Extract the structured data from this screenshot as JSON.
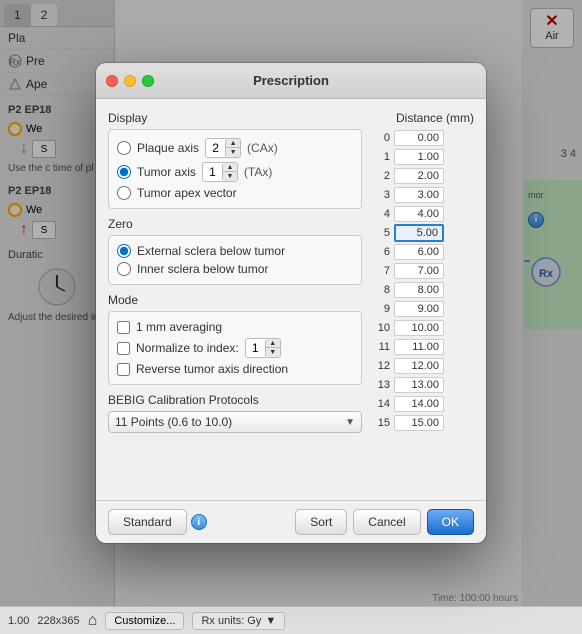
{
  "app": {
    "title": "Prescription",
    "bottom_bar": {
      "zoom": "1.00",
      "dimensions": "228x365",
      "customize_label": "Customize...",
      "rx_units_label": "Rx units: Gy"
    }
  },
  "sidebar": {
    "tabs": [
      {
        "label": "1",
        "active": false
      },
      {
        "label": "2",
        "active": false
      }
    ],
    "items": [
      {
        "label": "Pla"
      },
      {
        "label": "Pre"
      },
      {
        "label": "Ape"
      }
    ],
    "section1": "P2 EP18",
    "item1": "We",
    "section2": "P2 EP18",
    "item2": "We",
    "use_text": "Use the c time of pl",
    "duration_label": "Duratic",
    "adjust_text": "Adjust the desired in"
  },
  "dialog": {
    "title": "Prescription",
    "traffic_lights": {
      "close": "close",
      "minimize": "minimize",
      "maximize": "maximize"
    },
    "display_section": {
      "label": "Display",
      "plaque_axis": {
        "label": "Plaque axis",
        "value": "2",
        "tag": "(CAx)"
      },
      "tumor_axis": {
        "label": "Tumor axis",
        "value": "1",
        "tag": "(TAx)",
        "selected": true
      },
      "tumor_apex_vector": {
        "label": "Tumor apex vector"
      }
    },
    "zero_section": {
      "label": "Zero",
      "external_sclera": {
        "label": "External sclera below tumor",
        "selected": true
      },
      "inner_sclera": {
        "label": "Inner sclera below tumor"
      }
    },
    "mode_section": {
      "label": "Mode",
      "averaging": {
        "label": "1 mm averaging",
        "checked": false
      },
      "normalize": {
        "label": "Normalize to index:",
        "value": "1",
        "checked": false
      },
      "reverse": {
        "label": "Reverse tumor axis direction",
        "checked": false
      }
    },
    "calibration_section": {
      "label": "BEBIG Calibration Protocols",
      "dropdown_value": "11 Points (0.6 to 10.0)"
    },
    "distance_table": {
      "header": "Distance (mm)",
      "rows": [
        {
          "index": "0",
          "value": "0.00"
        },
        {
          "index": "1",
          "value": "1.00"
        },
        {
          "index": "2",
          "value": "2.00"
        },
        {
          "index": "3",
          "value": "3.00"
        },
        {
          "index": "4",
          "value": "4.00"
        },
        {
          "index": "5",
          "value": "5.00",
          "highlighted": true
        },
        {
          "index": "6",
          "value": "6.00"
        },
        {
          "index": "7",
          "value": "7.00"
        },
        {
          "index": "8",
          "value": "8.00"
        },
        {
          "index": "9",
          "value": "9.00"
        },
        {
          "index": "10",
          "value": "10.00"
        },
        {
          "index": "11",
          "value": "11.00"
        },
        {
          "index": "12",
          "value": "12.00"
        },
        {
          "index": "13",
          "value": "13.00"
        },
        {
          "index": "14",
          "value": "14.00"
        },
        {
          "index": "15",
          "value": "15.00"
        }
      ]
    },
    "footer": {
      "standard_label": "Standard",
      "sort_label": "Sort",
      "cancel_label": "Cancel",
      "ok_label": "OK"
    }
  }
}
